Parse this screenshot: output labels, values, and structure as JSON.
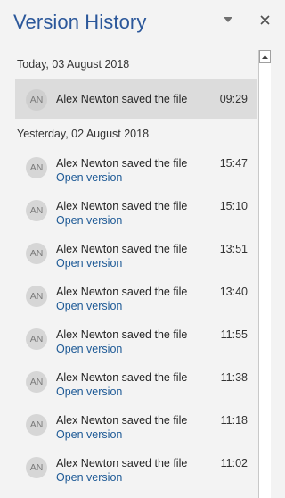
{
  "panel": {
    "title": "Version History",
    "dropdown_icon": "chevron-down-icon",
    "close_icon": "close-icon",
    "close_glyph": "✕"
  },
  "groups": [
    {
      "header": "Today, 03 August 2018",
      "entries": [
        {
          "initials": "AN",
          "text": "Alex Newton saved the file",
          "time": "09:29",
          "link": ""
        }
      ]
    },
    {
      "header": "Yesterday, 02 August 2018",
      "entries": [
        {
          "initials": "AN",
          "text": "Alex Newton saved the file",
          "time": "15:47",
          "link": "Open version"
        },
        {
          "initials": "AN",
          "text": "Alex Newton saved the file",
          "time": "15:10",
          "link": "Open version"
        },
        {
          "initials": "AN",
          "text": "Alex Newton saved the file",
          "time": "13:51",
          "link": "Open version"
        },
        {
          "initials": "AN",
          "text": "Alex Newton saved the file",
          "time": "13:40",
          "link": "Open version"
        },
        {
          "initials": "AN",
          "text": "Alex Newton saved the file",
          "time": "11:55",
          "link": "Open version"
        },
        {
          "initials": "AN",
          "text": "Alex Newton saved the file",
          "time": "11:38",
          "link": "Open version"
        },
        {
          "initials": "AN",
          "text": "Alex Newton saved the file",
          "time": "11:18",
          "link": "Open version"
        },
        {
          "initials": "AN",
          "text": "Alex Newton saved the file",
          "time": "11:02",
          "link": "Open version"
        }
      ]
    }
  ],
  "colors": {
    "title": "#2b579a",
    "link": "#1e5a96",
    "selected_row": "#dcdcdc",
    "background": "#f3f3f3"
  }
}
